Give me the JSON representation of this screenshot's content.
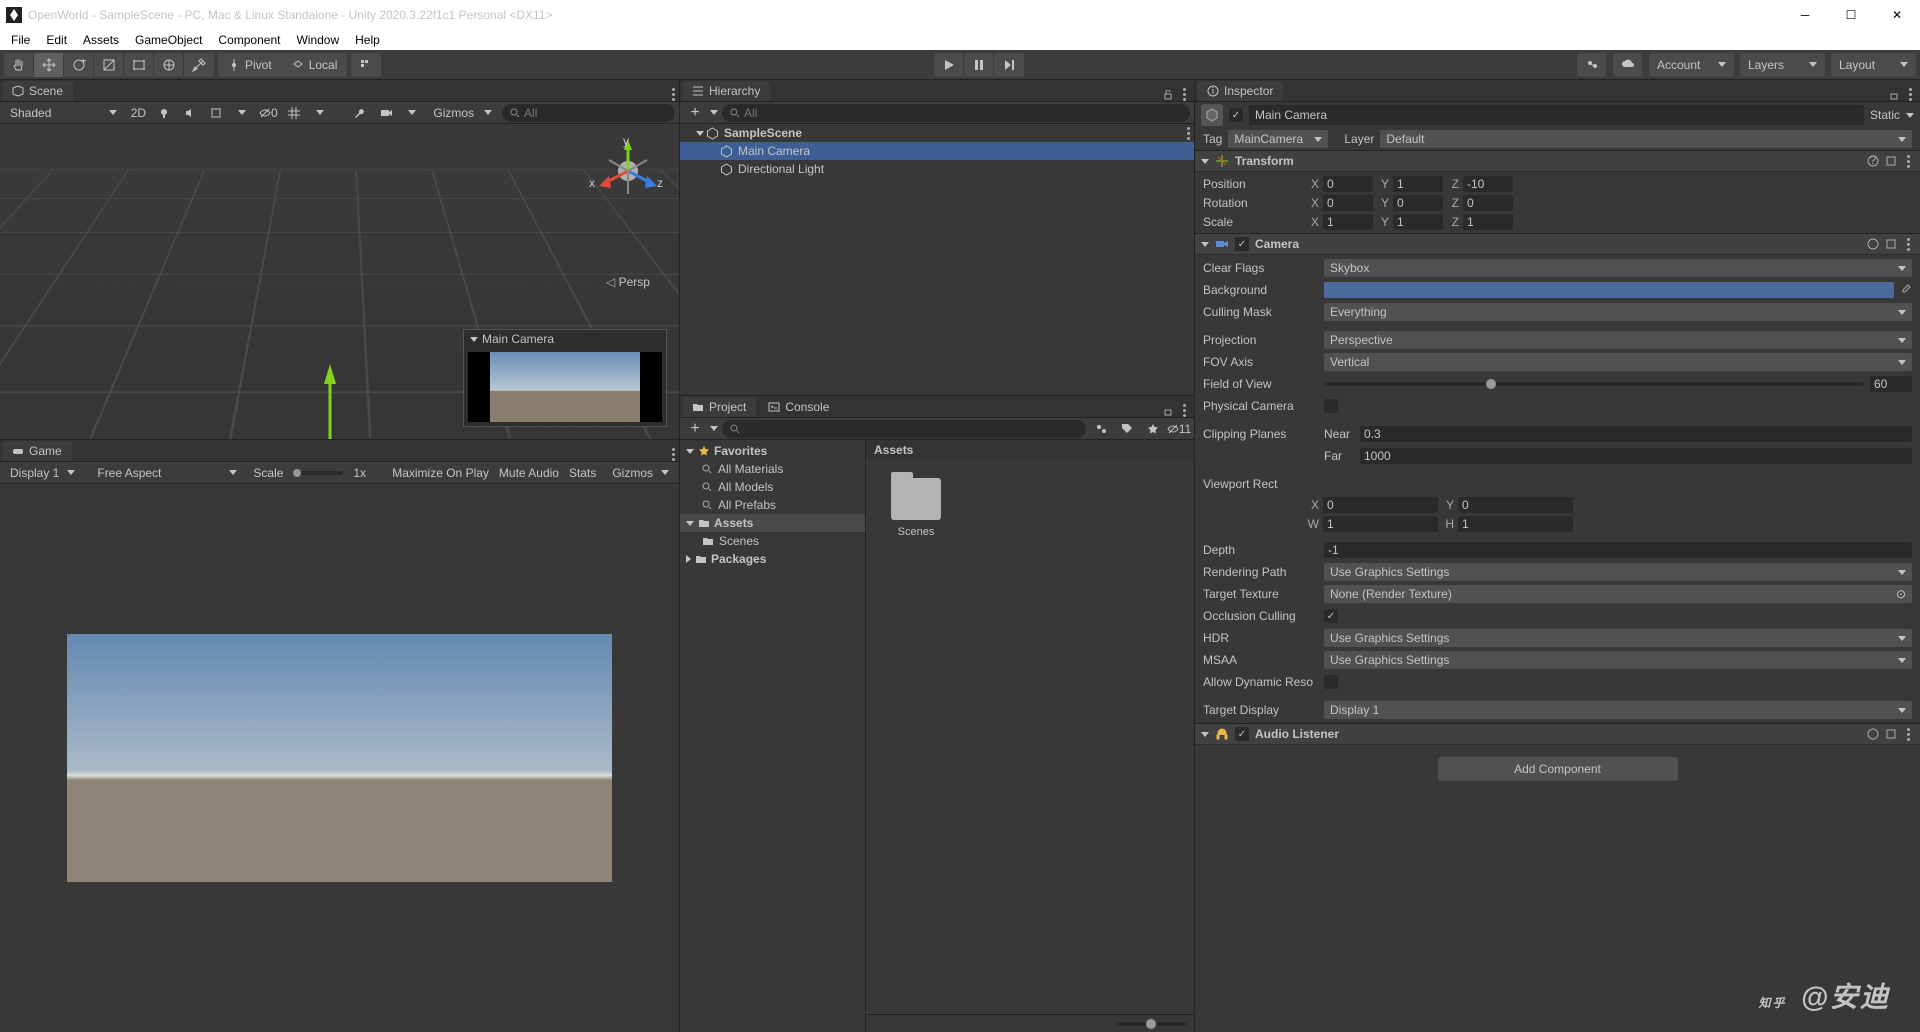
{
  "window": {
    "title": "OpenWorld - SampleScene - PC, Mac & Linux Standalone - Unity 2020.3.22f1c1 Personal <DX11>"
  },
  "menu": [
    "File",
    "Edit",
    "Assets",
    "GameObject",
    "Component",
    "Window",
    "Help"
  ],
  "toolbar": {
    "pivot": "Pivot",
    "local": "Local",
    "account": "Account",
    "layers": "Layers",
    "layout": "Layout"
  },
  "scene": {
    "tab": "Scene",
    "shading": "Shaded",
    "mode2d": "2D",
    "hidden": "0",
    "gizmos": "Gizmos",
    "search_ph": "All",
    "persp": "Persp",
    "cam_preview_title": "Main Camera",
    "axis": {
      "x": "x",
      "y": "y",
      "z": "z"
    }
  },
  "game": {
    "tab": "Game",
    "display": "Display 1",
    "aspect": "Free Aspect",
    "scale_lbl": "Scale",
    "scale_val": "1x",
    "maximize": "Maximize On Play",
    "mute": "Mute Audio",
    "stats": "Stats",
    "gizmos": "Gizmos"
  },
  "hierarchy": {
    "tab": "Hierarchy",
    "search_ph": "All",
    "scene": "SampleScene",
    "items": [
      "Main Camera",
      "Directional Light"
    ]
  },
  "project": {
    "tab": "Project",
    "console_tab": "Console",
    "hidden_count": "11",
    "favorites": "Favorites",
    "fav_items": [
      "All Materials",
      "All Models",
      "All Prefabs"
    ],
    "assets": "Assets",
    "scenes": "Scenes",
    "packages": "Packages",
    "breadcrumb": "Assets",
    "folder_label": "Scenes"
  },
  "inspector": {
    "tab": "Inspector",
    "obj_name": "Main Camera",
    "static": "Static",
    "tag_lbl": "Tag",
    "tag_val": "MainCamera",
    "layer_lbl": "Layer",
    "layer_val": "Default",
    "transform": {
      "title": "Transform",
      "position": "Position",
      "rotation": "Rotation",
      "scale": "Scale",
      "pos": {
        "x": "0",
        "y": "1",
        "z": "-10"
      },
      "rot": {
        "x": "0",
        "y": "0",
        "z": "0"
      },
      "scl": {
        "x": "1",
        "y": "1",
        "z": "1"
      }
    },
    "camera": {
      "title": "Camera",
      "clear_flags": "Clear Flags",
      "clear_flags_val": "Skybox",
      "background": "Background",
      "culling": "Culling Mask",
      "culling_val": "Everything",
      "projection": "Projection",
      "projection_val": "Perspective",
      "fov_axis": "FOV Axis",
      "fov_axis_val": "Vertical",
      "fov": "Field of View",
      "fov_val": "60",
      "physical": "Physical Camera",
      "clipping": "Clipping Planes",
      "near": "Near",
      "near_val": "0.3",
      "far": "Far",
      "far_val": "1000",
      "viewport": "Viewport Rect",
      "vp": {
        "x": "0",
        "y": "0",
        "w": "1",
        "h": "1",
        "X": "X",
        "Y": "Y",
        "W": "W",
        "H": "H"
      },
      "depth": "Depth",
      "depth_val": "-1",
      "rendering": "Rendering Path",
      "rendering_val": "Use Graphics Settings",
      "target_tex": "Target Texture",
      "target_tex_val": "None (Render Texture)",
      "occlusion": "Occlusion Culling",
      "hdr": "HDR",
      "hdr_val": "Use Graphics Settings",
      "msaa": "MSAA",
      "msaa_val": "Use Graphics Settings",
      "dyn_res": "Allow Dynamic Reso",
      "target_disp": "Target Display",
      "target_disp_val": "Display 1"
    },
    "audio": {
      "title": "Audio Listener"
    },
    "add_component": "Add Component"
  },
  "watermark": {
    "brand": "知乎",
    "author": "@安迪"
  }
}
